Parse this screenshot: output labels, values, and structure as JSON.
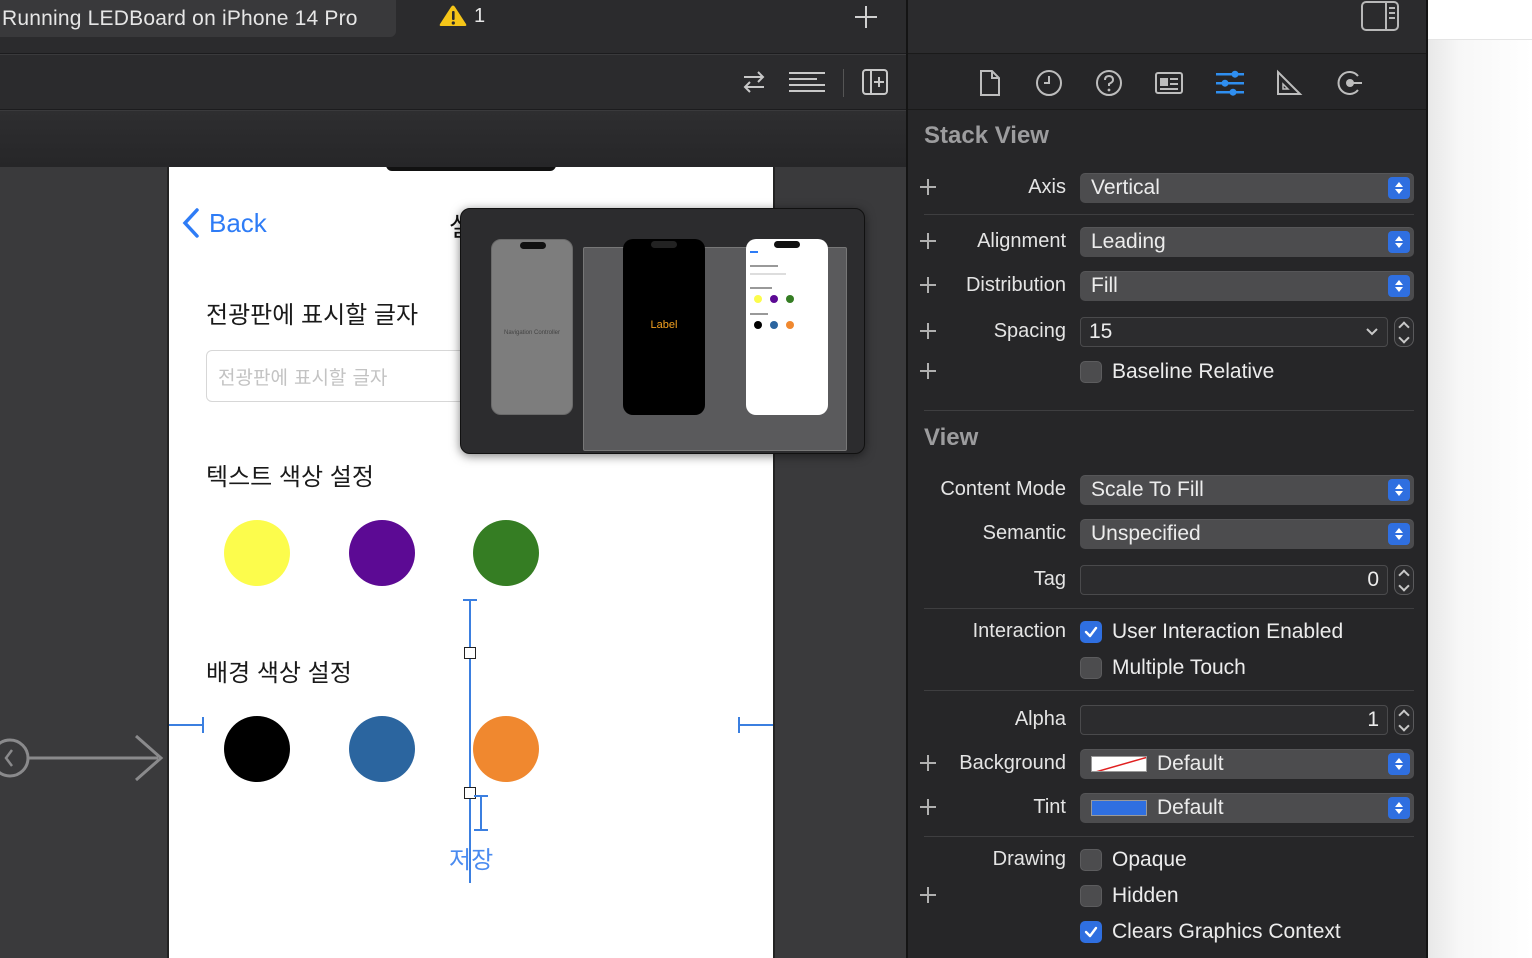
{
  "titlebar": {
    "run_status": "Running LEDBoard on iPhone 14 Pro",
    "warning_count": "1"
  },
  "icons": {
    "warning": "warning-triangle-icon",
    "add_tab": "plus-icon",
    "toolbar": [
      "swap-arrows-icon",
      "lines-icon",
      "add-panel-icon"
    ],
    "inspector_tabs": [
      "file-icon",
      "history-icon",
      "help-icon",
      "identity-card-icon",
      "sliders-icon",
      "ruler-icon",
      "connections-icon"
    ]
  },
  "phone": {
    "back_label": "Back",
    "nav_title_clip": "설",
    "text_section_label": "전광판에 표시할 글자",
    "text_input_placeholder": "전광판에 표시할 글자",
    "text_color_label": "텍스트 색상 설정",
    "bg_color_label": "배경 색상 설정",
    "save_label": "저장",
    "text_colors": [
      "#fcfc4c",
      "#5c0a94",
      "#357d23"
    ],
    "bg_colors": [
      "#000000",
      "#2b659f",
      "#f0882f"
    ]
  },
  "popover": {
    "thumb_1_label": "Navigation Controller",
    "thumb_2_label": "Label"
  },
  "inspector": {
    "stack_view": {
      "title": "Stack View",
      "axis_label": "Axis",
      "axis_value": "Vertical",
      "alignment_label": "Alignment",
      "alignment_value": "Leading",
      "distribution_label": "Distribution",
      "distribution_value": "Fill",
      "spacing_label": "Spacing",
      "spacing_value": "15",
      "baseline_label": "Baseline Relative",
      "baseline_checked": false
    },
    "view": {
      "title": "View",
      "content_mode_label": "Content Mode",
      "content_mode_value": "Scale To Fill",
      "semantic_label": "Semantic",
      "semantic_value": "Unspecified",
      "tag_label": "Tag",
      "tag_value": "0",
      "interaction_label": "Interaction",
      "user_interaction_label": "User Interaction Enabled",
      "user_interaction_checked": true,
      "multiple_touch_label": "Multiple Touch",
      "multiple_touch_checked": false,
      "alpha_label": "Alpha",
      "alpha_value": "1",
      "background_label": "Background",
      "background_value": "Default",
      "tint_label": "Tint",
      "tint_value": "Default",
      "tint_color": "#2f6fe0",
      "drawing_label": "Drawing",
      "opaque_label": "Opaque",
      "opaque_checked": false,
      "hidden_label": "Hidden",
      "hidden_checked": false,
      "clears_label": "Clears Graphics Context",
      "clears_checked": true
    }
  },
  "colors": {
    "accent": "#2f6fe0",
    "link": "#2e7cf6"
  }
}
